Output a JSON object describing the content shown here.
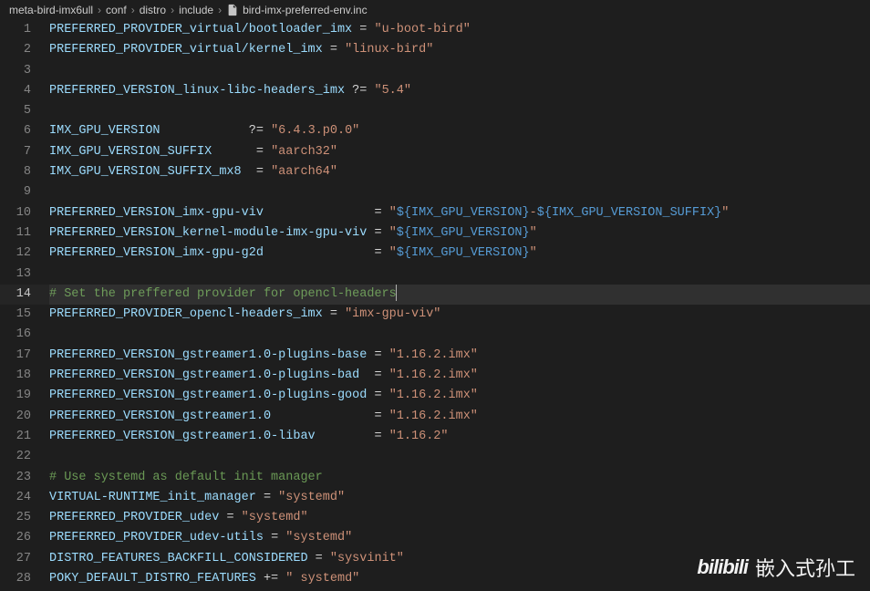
{
  "breadcrumb": {
    "items": [
      "meta-bird-imx6ull",
      "conf",
      "distro",
      "include",
      "bird-imx-preferred-env.inc"
    ]
  },
  "active_line": 14,
  "lines": [
    {
      "n": 1,
      "t": "PREFERRED_PROVIDER_virtual/bootloader_imx = \"u-boot-bird\"",
      "kind": "assign"
    },
    {
      "n": 2,
      "t": "PREFERRED_PROVIDER_virtual/kernel_imx = \"linux-bird\"",
      "kind": "assign"
    },
    {
      "n": 3,
      "t": "",
      "kind": "blank"
    },
    {
      "n": 4,
      "t": "PREFERRED_VERSION_linux-libc-headers_imx ?= \"5.4\"",
      "kind": "assign"
    },
    {
      "n": 5,
      "t": "",
      "kind": "blank"
    },
    {
      "n": 6,
      "t": "IMX_GPU_VERSION            ?= \"6.4.3.p0.0\"",
      "kind": "assign"
    },
    {
      "n": 7,
      "t": "IMX_GPU_VERSION_SUFFIX      = \"aarch32\"",
      "kind": "assign"
    },
    {
      "n": 8,
      "t": "IMX_GPU_VERSION_SUFFIX_mx8  = \"aarch64\"",
      "kind": "assign"
    },
    {
      "n": 9,
      "t": "",
      "kind": "blank"
    },
    {
      "n": 10,
      "t": "PREFERRED_VERSION_imx-gpu-viv               = \"${IMX_GPU_VERSION}-${IMX_GPU_VERSION_SUFFIX}\"",
      "kind": "assign-interp"
    },
    {
      "n": 11,
      "t": "PREFERRED_VERSION_kernel-module-imx-gpu-viv = \"${IMX_GPU_VERSION}\"",
      "kind": "assign-interp"
    },
    {
      "n": 12,
      "t": "PREFERRED_VERSION_imx-gpu-g2d               = \"${IMX_GPU_VERSION}\"",
      "kind": "assign-interp"
    },
    {
      "n": 13,
      "t": "",
      "kind": "blank"
    },
    {
      "n": 14,
      "t": "# Set the preffered provider for opencl-headers",
      "kind": "comment"
    },
    {
      "n": 15,
      "t": "PREFERRED_PROVIDER_opencl-headers_imx = \"imx-gpu-viv\"",
      "kind": "assign"
    },
    {
      "n": 16,
      "t": "",
      "kind": "blank"
    },
    {
      "n": 17,
      "t": "PREFERRED_VERSION_gstreamer1.0-plugins-base = \"1.16.2.imx\"",
      "kind": "assign"
    },
    {
      "n": 18,
      "t": "PREFERRED_VERSION_gstreamer1.0-plugins-bad  = \"1.16.2.imx\"",
      "kind": "assign"
    },
    {
      "n": 19,
      "t": "PREFERRED_VERSION_gstreamer1.0-plugins-good = \"1.16.2.imx\"",
      "kind": "assign"
    },
    {
      "n": 20,
      "t": "PREFERRED_VERSION_gstreamer1.0              = \"1.16.2.imx\"",
      "kind": "assign"
    },
    {
      "n": 21,
      "t": "PREFERRED_VERSION_gstreamer1.0-libav        = \"1.16.2\"",
      "kind": "assign"
    },
    {
      "n": 22,
      "t": "",
      "kind": "blank"
    },
    {
      "n": 23,
      "t": "# Use systemd as default init manager",
      "kind": "comment"
    },
    {
      "n": 24,
      "t": "VIRTUAL-RUNTIME_init_manager = \"systemd\"",
      "kind": "assign"
    },
    {
      "n": 25,
      "t": "PREFERRED_PROVIDER_udev = \"systemd\"",
      "kind": "assign"
    },
    {
      "n": 26,
      "t": "PREFERRED_PROVIDER_udev-utils = \"systemd\"",
      "kind": "assign"
    },
    {
      "n": 27,
      "t": "DISTRO_FEATURES_BACKFILL_CONSIDERED = \"sysvinit\"",
      "kind": "assign"
    },
    {
      "n": 28,
      "t": "POKY_DEFAULT_DISTRO_FEATURES += \" systemd\"",
      "kind": "assign"
    }
  ],
  "watermark": {
    "logo": "bilibili",
    "text": "嵌入式孙工"
  }
}
